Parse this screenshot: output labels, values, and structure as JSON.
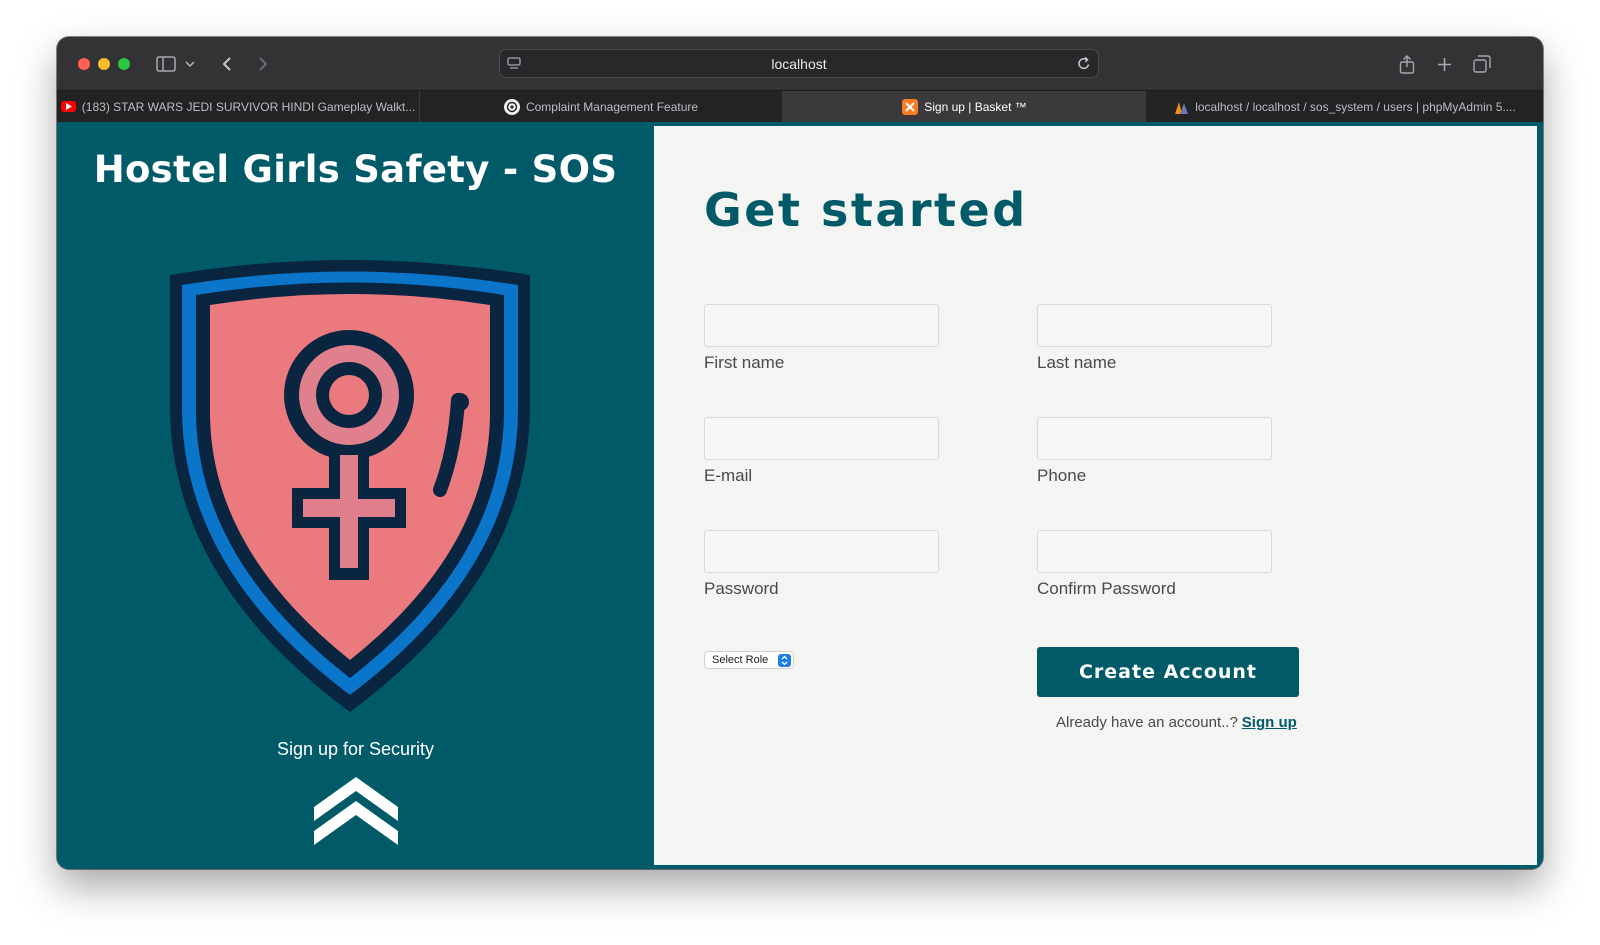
{
  "browser": {
    "address": "localhost",
    "tabs": [
      {
        "label": "(183) STAR WARS JEDI SURVIVOR HINDI Gameplay Walkt...",
        "favicon": "youtube-icon",
        "active": false
      },
      {
        "label": "Complaint Management Feature",
        "favicon": "openai-icon",
        "active": false
      },
      {
        "label": "Sign up | Basket ™",
        "favicon": "xampp-icon",
        "active": true
      },
      {
        "label": "localhost / localhost / sos_system / users | phpMyAdmin 5....",
        "favicon": "phpmyadmin-icon",
        "active": false
      }
    ],
    "close_glyph": "×"
  },
  "left_panel": {
    "title": "Hostel Girls Safety - SOS",
    "tagline": "Sign up for Security",
    "colors": {
      "background": "#015a68",
      "shield_outer": "#0a2540",
      "shield_blue": "#0b75c9",
      "shield_fill": "#ea7a7d",
      "symbol_fill": "#e0808c"
    }
  },
  "form": {
    "heading": "Get started",
    "fields": {
      "first_name": {
        "label": "First name",
        "value": ""
      },
      "last_name": {
        "label": "Last name",
        "value": ""
      },
      "email": {
        "label": "E-mail",
        "value": ""
      },
      "phone": {
        "label": "Phone",
        "value": ""
      },
      "password": {
        "label": "Password",
        "value": ""
      },
      "confirm_password": {
        "label": "Confirm Password",
        "value": ""
      }
    },
    "role_select": "Select Role",
    "submit_label": "Create Account",
    "login_prompt": "Already have an account..?",
    "login_link": "Sign up"
  }
}
